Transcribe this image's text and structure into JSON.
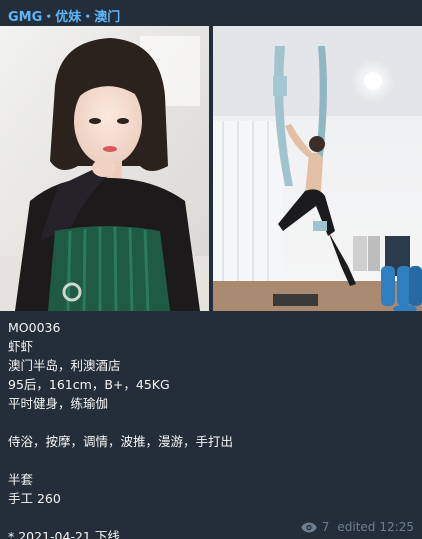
{
  "channel": {
    "title": "GMG・优妹・澳门"
  },
  "photos": [
    {
      "name": "portrait-photo"
    },
    {
      "name": "aerial-yoga-photo"
    }
  ],
  "caption": {
    "code": "MO0036",
    "nickname": "虾虾",
    "location": "澳门半岛，利澳酒店",
    "stats": "95后，161cm，B+，45KG",
    "hobbies": "平时健身，练瑜伽",
    "services": "侍浴，按摩，调情，波推，漫游，手打出",
    "package": "半套",
    "price": "手工 260",
    "date": "* 2021-04-21 下线"
  },
  "meta": {
    "icon": "eye-icon",
    "views": "7",
    "edited_label": "edited",
    "time": "12:25"
  },
  "colors": {
    "background": "#242e3a",
    "channel_title": "#5eb5f7",
    "text": "#f5f5f5",
    "meta": "#6d7f8f"
  }
}
